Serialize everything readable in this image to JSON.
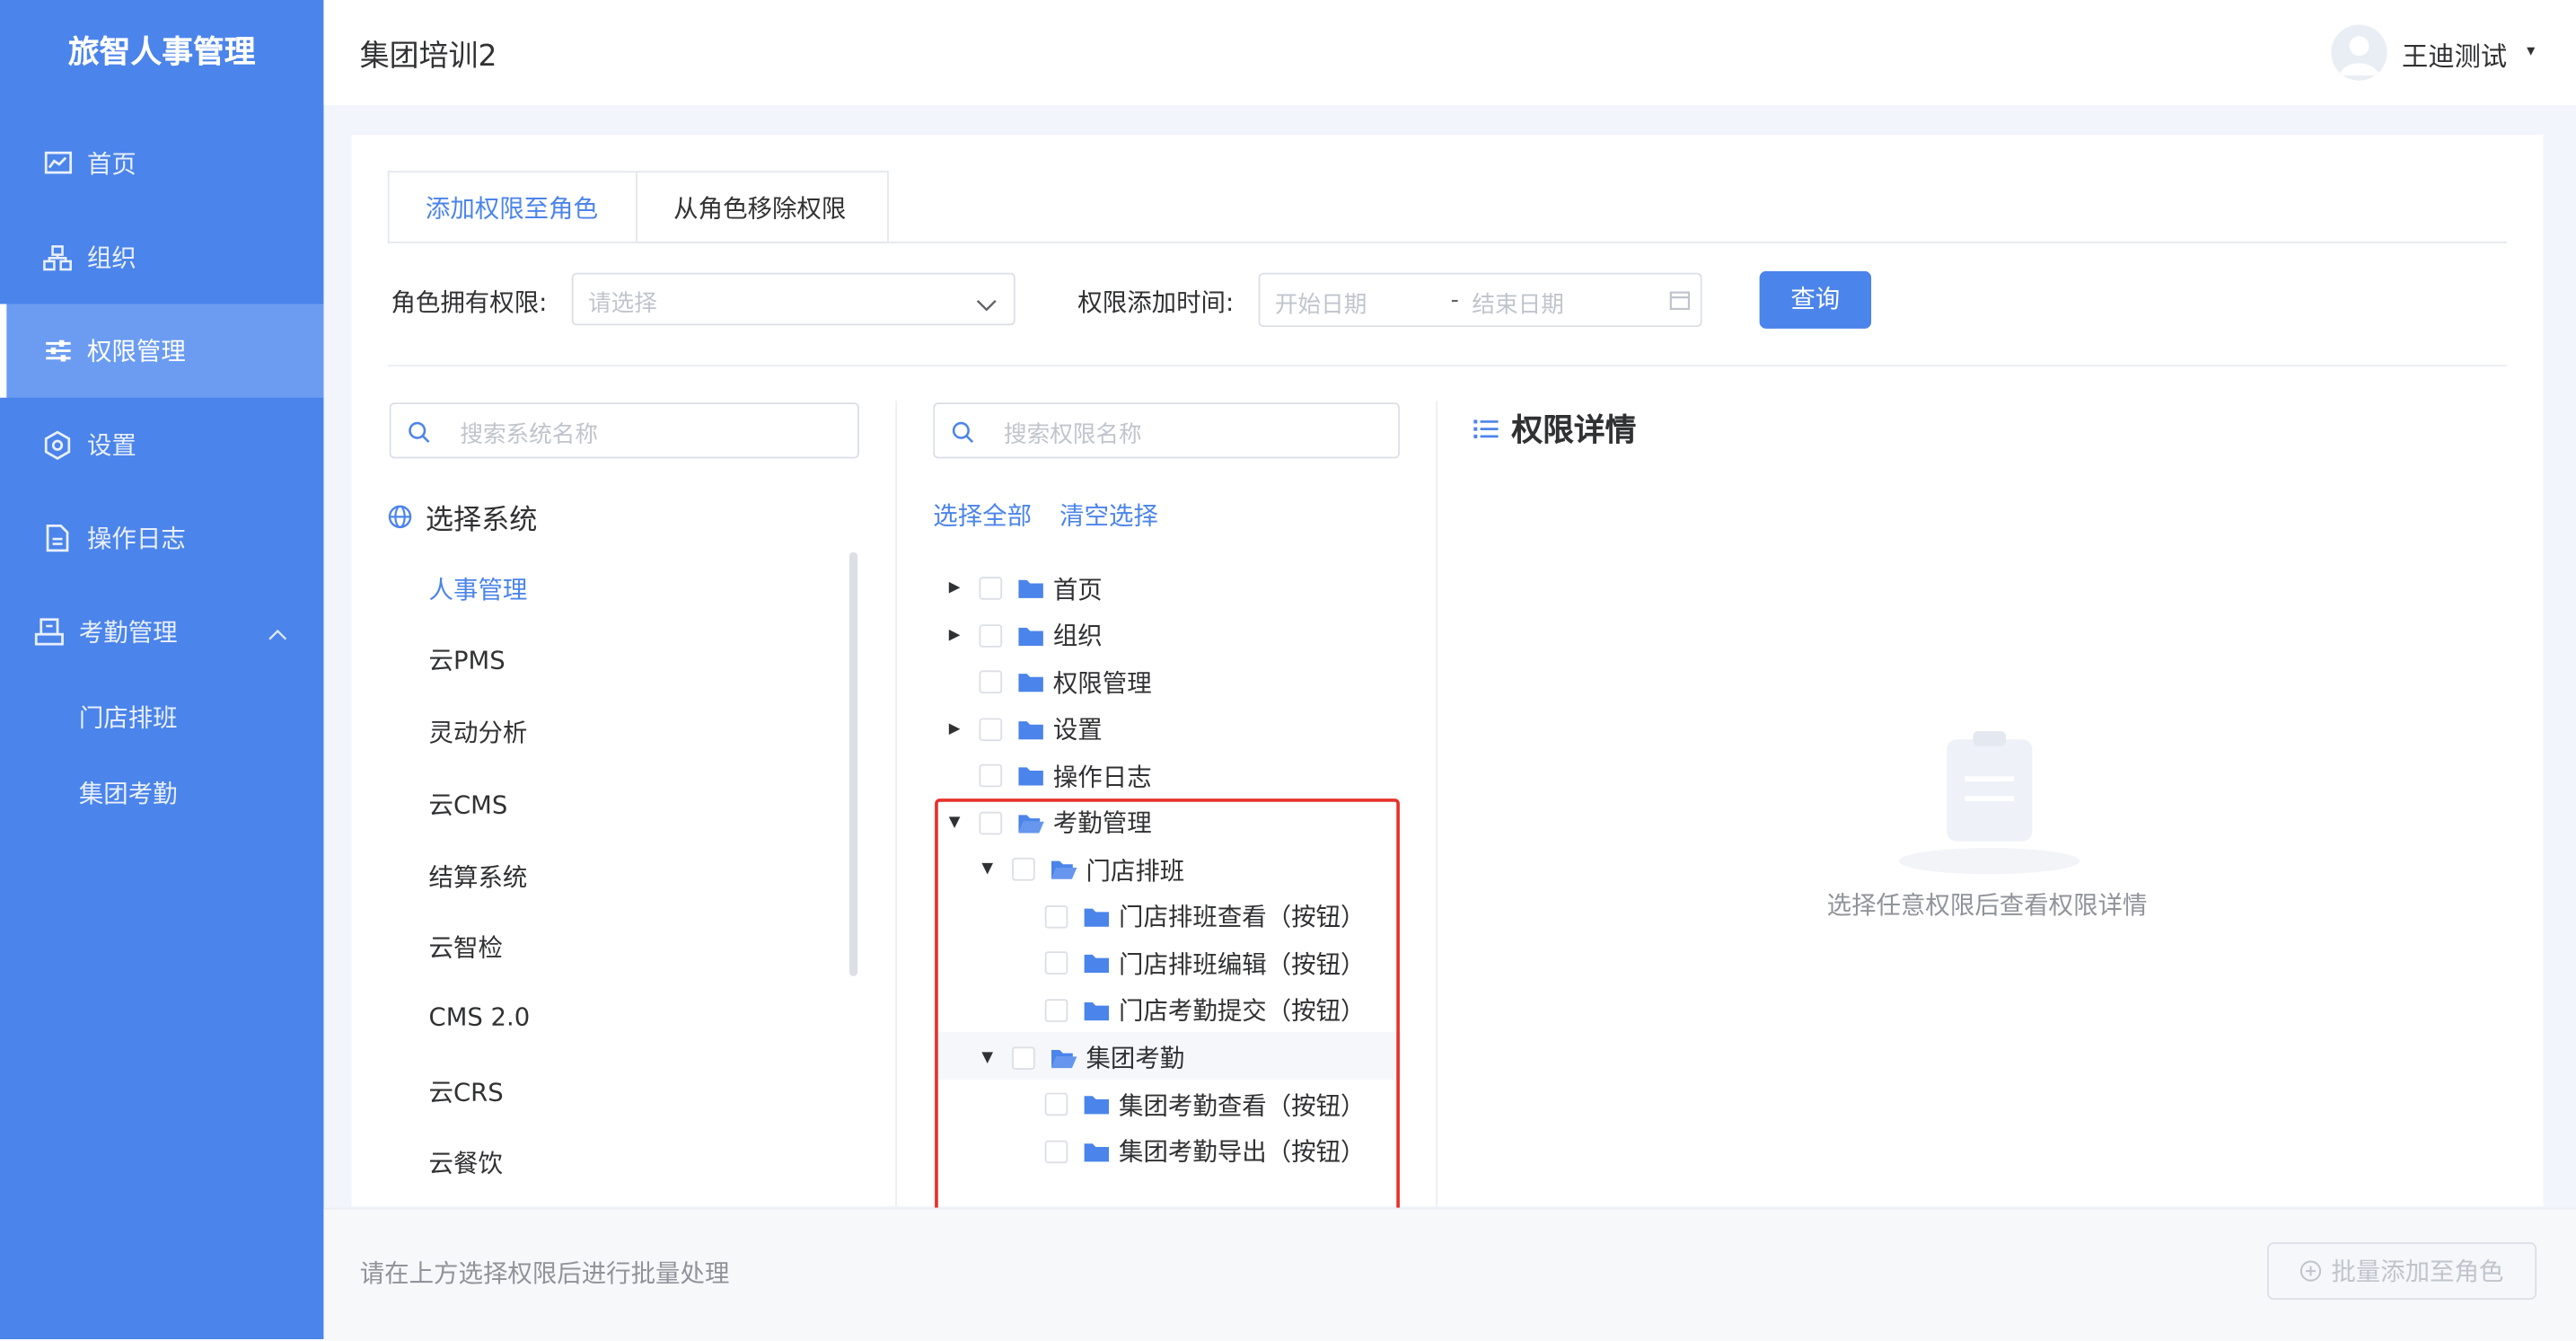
{
  "app": {
    "name": "旅智人事管理",
    "page_title": "集团培训2",
    "user": "王迪测试"
  },
  "sidebar": {
    "items": [
      {
        "label": "首页",
        "icon": "chart-icon"
      },
      {
        "label": "组织",
        "icon": "org-icon"
      },
      {
        "label": "权限管理",
        "icon": "sliders-icon",
        "active": true
      },
      {
        "label": "设置",
        "icon": "gear-icon"
      },
      {
        "label": "操作日志",
        "icon": "document-icon"
      },
      {
        "label": "考勤管理",
        "icon": "attendance-icon",
        "expanded": true
      }
    ],
    "sub_items": [
      "门店排班",
      "集团考勤"
    ]
  },
  "tabs": [
    {
      "label": "添加权限至角色",
      "active": true
    },
    {
      "label": "从角色移除权限",
      "active": false
    }
  ],
  "filters": {
    "role_perm_label": "角色拥有权限:",
    "role_perm_placeholder": "请选择",
    "time_label": "权限添加时间:",
    "start_placeholder": "开始日期",
    "separator": "-",
    "end_placeholder": "结束日期",
    "query_button": "查询"
  },
  "systems": {
    "search_placeholder": "搜索系统名称",
    "heading": "选择系统",
    "items": [
      "人事管理",
      "云PMS",
      "灵动分析",
      "云CMS",
      "结算系统",
      "云智检",
      "CMS 2.0",
      "云CRS",
      "云餐饮"
    ],
    "selected": "人事管理"
  },
  "permissions": {
    "search_placeholder": "搜索权限名称",
    "select_all": "选择全部",
    "clear": "清空选择",
    "tree": [
      {
        "label": "首页",
        "level": 0,
        "arrow": "right"
      },
      {
        "label": "组织",
        "level": 0,
        "arrow": "right"
      },
      {
        "label": "权限管理",
        "level": 0,
        "arrow": "none"
      },
      {
        "label": "设置",
        "level": 0,
        "arrow": "right"
      },
      {
        "label": "操作日志",
        "level": 0,
        "arrow": "none"
      },
      {
        "label": "考勤管理",
        "level": 0,
        "arrow": "down",
        "open": true
      },
      {
        "label": "门店排班",
        "level": 1,
        "arrow": "down",
        "open": true
      },
      {
        "label": "门店排班查看（按钮）",
        "level": 2,
        "arrow": "none"
      },
      {
        "label": "门店排班编辑（按钮）",
        "level": 2,
        "arrow": "none"
      },
      {
        "label": "门店考勤提交（按钮）",
        "level": 2,
        "arrow": "none"
      },
      {
        "label": "集团考勤",
        "level": 1,
        "arrow": "down",
        "open": true,
        "highlighted": true
      },
      {
        "label": "集团考勤查看（按钮）",
        "level": 2,
        "arrow": "none"
      },
      {
        "label": "集团考勤导出（按钮）",
        "level": 2,
        "arrow": "none"
      }
    ]
  },
  "detail": {
    "heading": "权限详情",
    "empty_text": "选择任意权限后查看权限详情"
  },
  "footer": {
    "hint": "请在上方选择权限后进行批量处理",
    "batch_button": "批量添加至角色"
  },
  "colors": {
    "primary": "#4b84ea",
    "annotation": "#e5322d"
  }
}
